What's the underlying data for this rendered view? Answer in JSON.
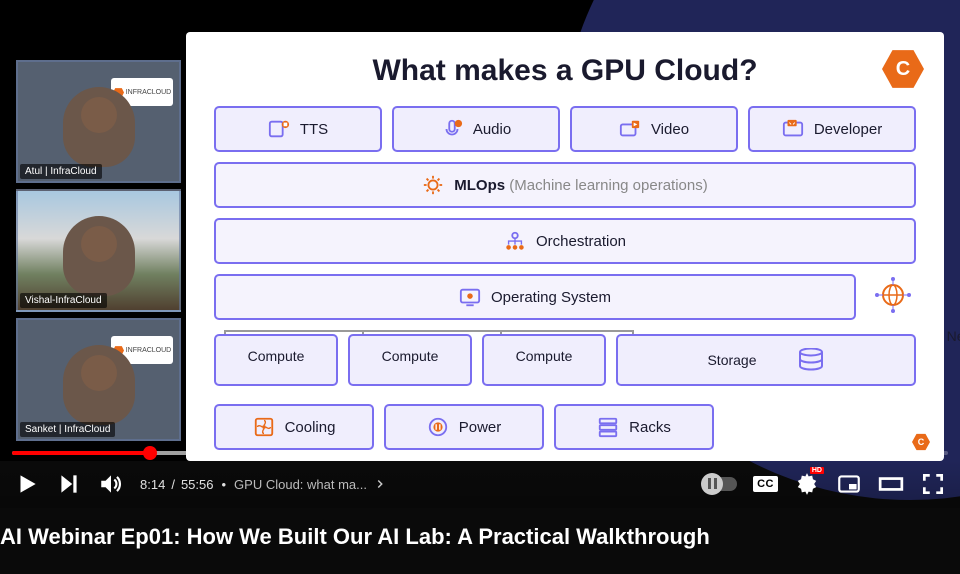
{
  "participants": [
    {
      "label": "Atul | InfraCloud"
    },
    {
      "label": "Vishal-InfraCloud"
    },
    {
      "label": "Sanket | InfraCloud"
    }
  ],
  "slide": {
    "title": "What makes a GPU Cloud?",
    "top_row": [
      {
        "label": "TTS"
      },
      {
        "label": "Audio"
      },
      {
        "label": "Video"
      },
      {
        "label": "Developer"
      }
    ],
    "mlops_label": "MLOps",
    "mlops_sub": "(Machine learning operations)",
    "orchestration_label": "Orchestration",
    "os_label": "Operating System",
    "network_label": "Network",
    "compute_row": [
      {
        "label": "Compute"
      },
      {
        "label": "Compute"
      },
      {
        "label": "Compute"
      },
      {
        "label": "Storage"
      }
    ],
    "util_row": [
      {
        "label": "Cooling"
      },
      {
        "label": "Power"
      },
      {
        "label": "Racks"
      }
    ]
  },
  "player": {
    "current_time": "8:14",
    "duration": "55:56",
    "chapter": "GPU Cloud: what ma...",
    "cc_text": "CC",
    "hd_text": "HD"
  },
  "video_title": "AI Webinar Ep01: How We Built Our AI Lab: A Practical Walkthrough",
  "brand_tag": "INFRACLOUD"
}
